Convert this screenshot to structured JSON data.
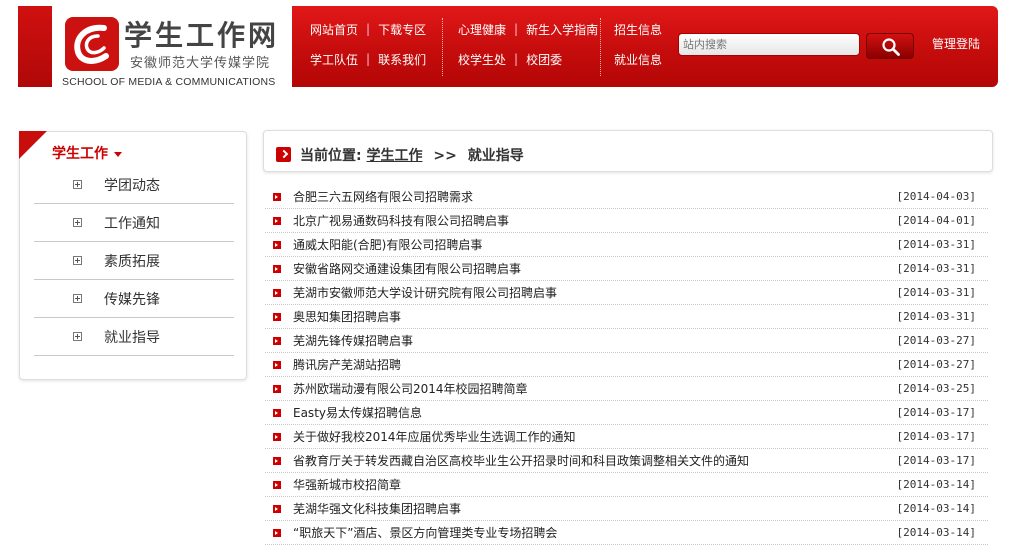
{
  "header": {
    "logo_title": "学生工作网",
    "logo_subtitle": "安徽师范大学传媒学院",
    "logo_english": "SCHOOL OF MEDIA & COMMUNICATIONS",
    "nav_group1": {
      "row1": [
        "网站首页",
        "下载专区"
      ],
      "row2": [
        "学工队伍",
        "联系我们"
      ]
    },
    "nav_group2": {
      "row1": [
        "心理健康",
        "新生入学指南"
      ],
      "row2": [
        "校学生处",
        "校团委"
      ]
    },
    "nav_group3": {
      "row1": [
        "招生信息"
      ],
      "row2": [
        "就业信息"
      ]
    },
    "search_placeholder": "站内搜索",
    "admin_login": "管理登陆",
    "accent_color": "#c80d0d"
  },
  "sidebar": {
    "title": "学生工作",
    "items": [
      {
        "label": "学团动态"
      },
      {
        "label": "工作通知"
      },
      {
        "label": "素质拓展"
      },
      {
        "label": "传媒先锋"
      },
      {
        "label": "就业指导"
      }
    ]
  },
  "breadcrumb": {
    "prefix": "当前位置:",
    "parent": "学生工作",
    "separator": ">>",
    "current": "就业指导"
  },
  "news": [
    {
      "title": "合肥三六五网络有限公司招聘需求",
      "date": "[2014-04-03]"
    },
    {
      "title": "北京广视易通数码科技有限公司招聘启事",
      "date": "[2014-04-01]"
    },
    {
      "title": "通威太阳能(合肥)有限公司招聘启事",
      "date": "[2014-03-31]"
    },
    {
      "title": "安徽省路网交通建设集团有限公司招聘启事",
      "date": "[2014-03-31]"
    },
    {
      "title": "芜湖市安徽师范大学设计研究院有限公司招聘启事",
      "date": "[2014-03-31]"
    },
    {
      "title": "奥思知集团招聘启事",
      "date": "[2014-03-31]"
    },
    {
      "title": "芜湖先锋传媒招聘启事",
      "date": "[2014-03-27]"
    },
    {
      "title": "腾讯房产芜湖站招聘",
      "date": "[2014-03-27]"
    },
    {
      "title": "苏州欧瑞动漫有限公司2014年校园招聘简章",
      "date": "[2014-03-25]"
    },
    {
      "title": "Easty易太传媒招聘信息",
      "date": "[2014-03-17]"
    },
    {
      "title": "关于做好我校2014年应届优秀毕业生选调工作的通知",
      "date": "[2014-03-17]"
    },
    {
      "title": "省教育厅关于转发西藏自治区高校毕业生公开招录时间和科目政策调整相关文件的通知",
      "date": "[2014-03-17]"
    },
    {
      "title": "华强新城市校招简章",
      "date": "[2014-03-14]"
    },
    {
      "title": "芜湖华强文化科技集团招聘启事",
      "date": "[2014-03-14]"
    },
    {
      "title": "“职旅天下”酒店、景区方向管理类专业专场招聘会",
      "date": "[2014-03-14]"
    }
  ]
}
